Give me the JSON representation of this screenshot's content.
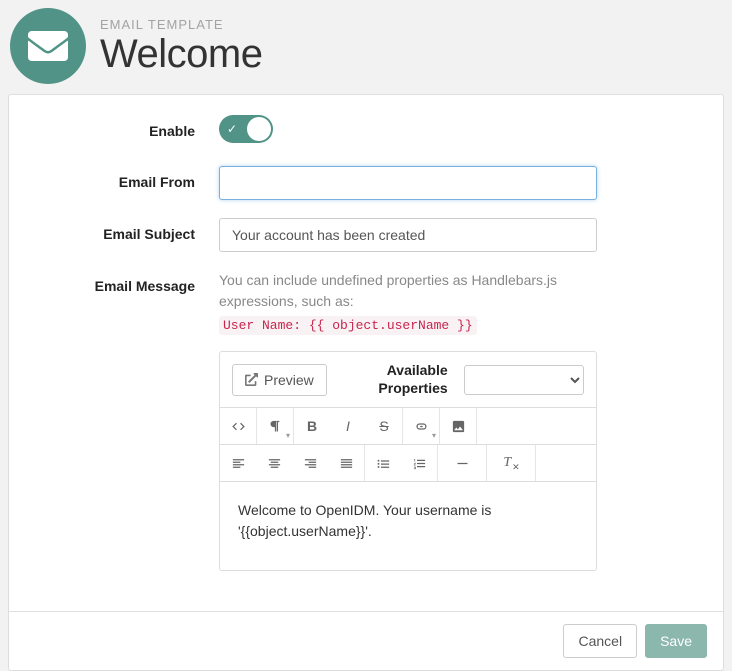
{
  "header": {
    "label": "EMAIL TEMPLATE",
    "title": "Welcome"
  },
  "form": {
    "enable": {
      "label": "Enable",
      "value": true
    },
    "from": {
      "label": "Email From",
      "value": ""
    },
    "subject": {
      "label": "Email Subject",
      "value": "Your account has been created"
    },
    "message": {
      "label": "Email Message",
      "helper": "You can include undefined properties as Handlebars.js expressions, such as:",
      "code_sample": "User Name: {{ object.userName }}"
    }
  },
  "editor": {
    "preview_label": "Preview",
    "available_label": "Available Properties",
    "available_selected": "",
    "content": "Welcome to OpenIDM. Your username is '{{object.userName}}'."
  },
  "footer": {
    "cancel": "Cancel",
    "save": "Save"
  }
}
